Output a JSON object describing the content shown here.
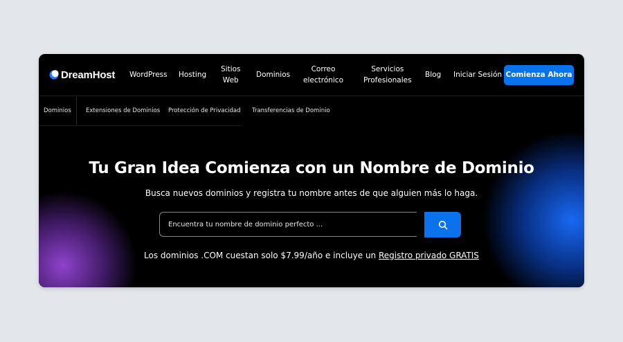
{
  "brand": {
    "name": "DreamHost",
    "logo_icon": "crescent-moon-icon"
  },
  "nav": {
    "items": [
      {
        "label": "WordPress"
      },
      {
        "label": "Hosting"
      },
      {
        "label_lines": [
          "Sitios",
          "Web"
        ]
      },
      {
        "label": "Dominios"
      },
      {
        "label_lines": [
          "Correo",
          "electrónico"
        ]
      },
      {
        "label_lines": [
          "Servicios",
          "Profesionales"
        ]
      },
      {
        "label": "Blog"
      },
      {
        "label": "Iniciar Sesión"
      }
    ],
    "cta_label": "Comienza Ahora"
  },
  "subnav": {
    "items": [
      {
        "label": "Dominios"
      },
      {
        "label": "Extensiones de Dominios"
      },
      {
        "label": "Protección de Privacidad"
      },
      {
        "label": "Transferencias de Dominio"
      }
    ]
  },
  "hero": {
    "title": "Tu Gran Idea Comienza con un Nombre de Dominio",
    "subtitle": "Busca nuevos dominios y registra tu nombre antes de que alguien más lo haga."
  },
  "search": {
    "value": "",
    "placeholder": "Encuentra tu nombre de dominio perfecto ...",
    "button_icon": "search-icon"
  },
  "promo": {
    "text": "Los dominios .COM cuestan solo $7.99/año e incluye un ",
    "link_label": "Registro privado GRATIS"
  },
  "colors": {
    "page_background": "#e3e6ea",
    "window_background": "#000000",
    "accent_blue": "#0a73eb",
    "glow_purple": "#9646d7",
    "glow_blue": "#196eff",
    "text": "#ffffff"
  }
}
